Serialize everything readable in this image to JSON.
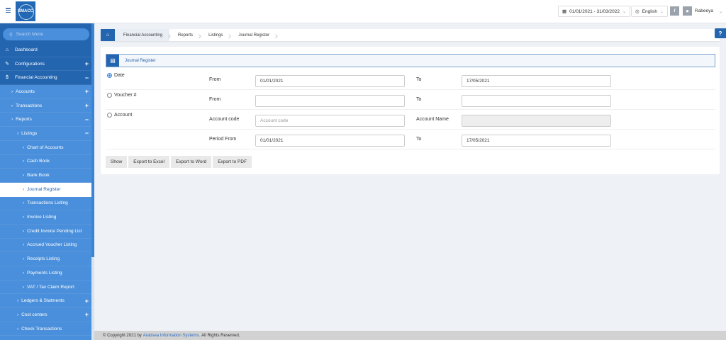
{
  "header": {
    "logo": "SMACC",
    "date_range": "01/01/2021 - 31/03/2022",
    "language": "English",
    "info": "i",
    "user": "Rabeeya"
  },
  "sidebar": {
    "search_placeholder": "Search Menu",
    "items": [
      {
        "label": "Dashboard",
        "icon": "home-icon",
        "glyph": "⌂",
        "level": 0
      },
      {
        "label": "Configurations",
        "icon": "wrench-icon",
        "glyph": "✎",
        "level": 0,
        "toggle": "+"
      },
      {
        "label": "Financial Accounting",
        "icon": "dollar-icon",
        "glyph": "$",
        "level": 0,
        "toggle": "−"
      },
      {
        "label": "Accounts",
        "level": 1,
        "toggle": "+"
      },
      {
        "label": "Transactions",
        "level": 1,
        "toggle": "+"
      },
      {
        "label": "Reports",
        "level": 1,
        "toggle": "−"
      },
      {
        "label": "Listings",
        "level": 2,
        "toggle": "−"
      },
      {
        "label": "Chart of Accounts",
        "level": 3
      },
      {
        "label": "Cash Book",
        "level": 3
      },
      {
        "label": "Bank Book",
        "level": 3
      },
      {
        "label": "Journal Register",
        "level": 3,
        "active": true
      },
      {
        "label": "Transactions Listing",
        "level": 3
      },
      {
        "label": "Invoice Listing",
        "level": 3
      },
      {
        "label": "Credit Invoice Pending List",
        "level": 3
      },
      {
        "label": "Accrued Voucher Listing",
        "level": 3
      },
      {
        "label": "Receipts Listing",
        "level": 3
      },
      {
        "label": "Payments Listing",
        "level": 3
      },
      {
        "label": "VAT / Tax Claim Report",
        "level": 3
      },
      {
        "label": "Ledgers & Statments",
        "level": 2,
        "toggle": "+"
      },
      {
        "label": "Cost centers",
        "level": 2,
        "toggle": "+"
      },
      {
        "label": "Check Transactions",
        "level": 2
      }
    ]
  },
  "breadcrumb": [
    "Financial Accounting",
    "Reports",
    "Listings",
    "Journal Register"
  ],
  "panel": {
    "title": "Journal Register"
  },
  "form": {
    "date": {
      "label": "Date",
      "checked": true,
      "from_label": "From",
      "from": "01/01/2021",
      "to_label": "To",
      "to": "17/05/2021"
    },
    "voucher": {
      "label": "Voucher #",
      "checked": false,
      "from_label": "From",
      "from": "",
      "to_label": "To",
      "to": ""
    },
    "account": {
      "label": "Account",
      "checked": false,
      "code_label": "Account code",
      "code_placeholder": "Account code",
      "name_label": "Account Name",
      "name": ""
    },
    "period": {
      "from_label": "Period From",
      "from": "01/01/2021",
      "to_label": "To",
      "to": "17/05/2021"
    }
  },
  "buttons": {
    "show": "Show",
    "excel": "Export to Excel",
    "word": "Export to Word",
    "pdf": "Export to PDF"
  },
  "footer": {
    "prefix": "© Copyright 2021 by",
    "company": "Arabsea Information Systems.",
    "suffix": "All Rights Reserved."
  },
  "colors": {
    "primary": "#2465b0",
    "sidebar_sub": "#4a8fdb"
  }
}
